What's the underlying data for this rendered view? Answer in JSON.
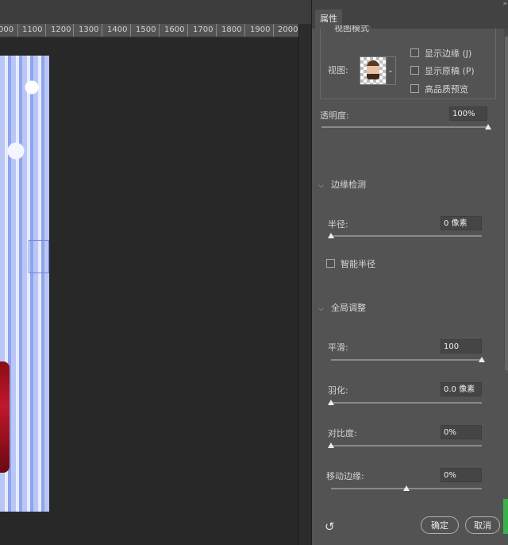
{
  "ruler": {
    "ticks": [
      "000",
      "1100",
      "1200",
      "1300",
      "1400",
      "1500",
      "1600",
      "1700",
      "1800",
      "1900",
      "2000"
    ]
  },
  "panel": {
    "tab_title": "属性",
    "collapse_glyph": "»",
    "view_mode": {
      "title": "视图模式",
      "view_label": "视图:",
      "dropdown_arrow": "⌄",
      "show_edge": "显示边缘 (J)",
      "show_original": "显示原稿 (P)",
      "hq_preview": "高品质预览"
    },
    "opacity": {
      "label": "透明度:",
      "value": "100%",
      "level": 1.0
    },
    "edge_detection": {
      "title": "边缘检测",
      "radius_label": "半径:",
      "radius_value": "0 像素",
      "radius_level": 0.0,
      "smart_radius": "智能半径"
    },
    "global_refine": {
      "title": "全局调整",
      "smooth_label": "平滑:",
      "smooth_value": "100",
      "smooth_level": 1.0,
      "feather_label": "羽化:",
      "feather_value": "0.0 像素",
      "feather_level": 0.0,
      "contrast_label": "对比度:",
      "contrast_value": "0%",
      "contrast_level": 0.0,
      "shift_edge_label": "移动边缘:",
      "shift_edge_value": "0%",
      "shift_edge_level": 0.5
    },
    "reset_icon": "↺",
    "ok_label": "确定",
    "cancel_label": "取消"
  }
}
